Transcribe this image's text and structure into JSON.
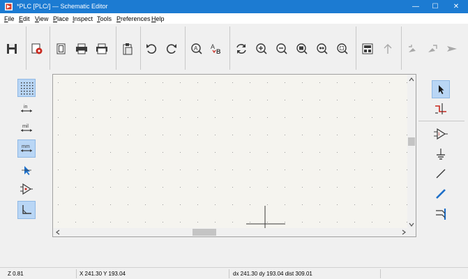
{
  "window": {
    "title": "*PLC [PLC/] — Schematic Editor",
    "minimize_glyph": "—",
    "maximize_glyph": "☐",
    "close_glyph": "✕",
    "titlebar_color": "#1c7bd2"
  },
  "menu": [
    {
      "key": "F",
      "rest": "ile"
    },
    {
      "key": "E",
      "rest": "dit"
    },
    {
      "key": "V",
      "rest": "iew"
    },
    {
      "key": "P",
      "rest": "lace"
    },
    {
      "key": "I",
      "rest": "nspect"
    },
    {
      "key": "T",
      "rest": "ools"
    },
    {
      "key": "P",
      "rest": "references"
    },
    {
      "key": "H",
      "rest": "elp"
    }
  ],
  "toolbar_icons": [
    "save-icon",
    "schematic-setup-icon",
    "page-settings-icon",
    "print-icon",
    "plot-icon",
    "paste-icon",
    "undo-icon",
    "redo-icon",
    "find-icon",
    "find-replace-icon",
    "redraw-icon",
    "zoom-in-icon",
    "zoom-out-icon",
    "zoom-fit-icon",
    "zoom-objects-icon",
    "zoom-selection-icon",
    "hierarchy-navigator-icon",
    "leave-sheet-icon",
    "annotate-icon",
    "erc-icon",
    "netlist-icon"
  ],
  "left_toolbar_icons": [
    "grid-toggle-icon",
    "inch-units-icon",
    "mil-units-icon",
    "mm-units-icon",
    "cursor-style-icon",
    "hidden-pins-icon",
    "wire-angle-icon"
  ],
  "left_units": {
    "inch": "in",
    "mil": "mil",
    "mm": "mm"
  },
  "right_toolbar_icons": [
    "select-icon",
    "highlight-net-icon",
    "add-symbol-icon",
    "add-power-icon",
    "add-wire-icon",
    "add-bus-icon",
    "bus-entry-icon"
  ],
  "status": {
    "zoom": "Z 0.81",
    "cursor": "X 241.30  Y 193.04",
    "delta": "dx 241.30  dy 193.04  dist 309.01"
  },
  "colors": {
    "canvas_bg": "#f5f4ef",
    "grid_dot": "#9a9a9a",
    "active_tool_bg": "#b9d6f5",
    "icon_dark": "#3a3a3a",
    "icon_accent": "#1e6fc8",
    "icon_red": "#c8291f",
    "icon_disabled": "#a8a8a8"
  }
}
